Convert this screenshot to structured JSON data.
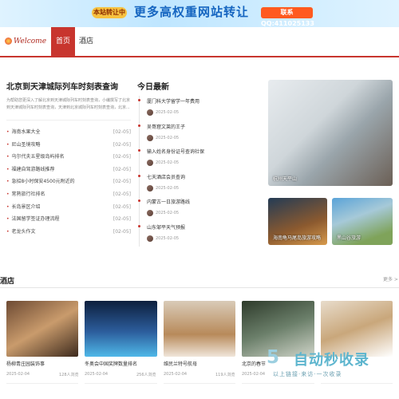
{
  "banner": {
    "tag": "本站转让中",
    "headline": "更多高权重网站转让",
    "contact": "联系QQ:411025133"
  },
  "header": {
    "logo_text": "Welcome",
    "tabs": [
      {
        "label": "首页",
        "active": true
      },
      {
        "label": "酒店",
        "active": false
      }
    ]
  },
  "featured": {
    "title": "北京到天津城际列车时刻表查询",
    "intro": "为帮助您更深入了解北京到天津城际列车时刻表查询，小编撰写了北京到天津城际列车时刻表查询，天津到北京城际列车时刻表查询，北京..."
  },
  "list_items": [
    {
      "title": "海南水果大全",
      "date": "[02-05]"
    },
    {
      "title": "尼山圣境攻略",
      "date": "[02-05]"
    },
    {
      "title": "乌尔代夫五星级岛屿排名",
      "date": "[02-05]"
    },
    {
      "title": "福建自驾游路线推荐",
      "date": "[02-05]"
    },
    {
      "title": "急招8小时保安4500元附近的",
      "date": "[02-05]"
    },
    {
      "title": "常熟旅行社排名",
      "date": "[02-05]"
    },
    {
      "title": "长岛景区介绍",
      "date": "[02-05]"
    },
    {
      "title": "法国留学签证办理流程",
      "date": "[02-05]"
    },
    {
      "title": "老龙头作文",
      "date": "[02-05]"
    }
  ],
  "latest": {
    "title": "今日最新",
    "items": [
      {
        "title": "厦门科大学留学一年费用",
        "date": "2025-02-05"
      },
      {
        "title": "吴哥窟文莱的王子",
        "date": "2025-02-05"
      },
      {
        "title": "输入姓名身份证号查询社保",
        "date": "2025-02-05"
      },
      {
        "title": "七天酒店会员查询",
        "date": "2025-02-05"
      },
      {
        "title": "内蒙古一日旅游路线",
        "date": "2025-02-05"
      },
      {
        "title": "山东邹平天气预报",
        "date": "2025-02-05"
      }
    ]
  },
  "cards": [
    {
      "caption": "杭州天平山"
    },
    {
      "caption": "海南龟马尾岛旅游攻略"
    },
    {
      "caption": "黑山谷旅游"
    }
  ],
  "hotels": {
    "title": "酒店",
    "more": "更多 >",
    "items": [
      {
        "title": "杨柳青庄园装饰事",
        "date": "2025-02-04",
        "views": "128人浏览"
      },
      {
        "title": "冬奥会中国奖牌数量排名",
        "date": "2025-02-04",
        "views": "256人浏览"
      },
      {
        "title": "维民兰特号航母",
        "date": "2025-02-04",
        "views": "119人浏览"
      },
      {
        "title": "北京的春节",
        "date": "2025-02-04",
        "views": ""
      },
      {
        "title": "",
        "date": "",
        "views": ""
      }
    ]
  },
  "watermark": {
    "mark": "5",
    "title": "自动秒收录",
    "tagline": "以上链接·来访·一次收录"
  }
}
